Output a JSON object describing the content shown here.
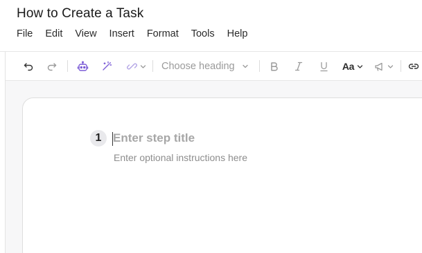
{
  "document": {
    "title": "How to Create a Task"
  },
  "menu": {
    "items": [
      "File",
      "Edit",
      "View",
      "Insert",
      "Format",
      "Tools",
      "Help"
    ]
  },
  "toolbar": {
    "heading_placeholder": "Choose heading",
    "font_size_label": "Aa",
    "icons": [
      "undo-icon",
      "redo-icon",
      "ai-assistant-icon",
      "magic-wand-icon",
      "link-chain-icon",
      "bold-icon",
      "italic-icon",
      "underline-icon",
      "font-size-icon",
      "announcement-icon",
      "link-icon"
    ],
    "accent_color": "#7b5bd6"
  },
  "editor": {
    "step": {
      "number": "1",
      "title_placeholder": "Enter step title",
      "instructions_placeholder": "Enter optional instructions here"
    }
  }
}
